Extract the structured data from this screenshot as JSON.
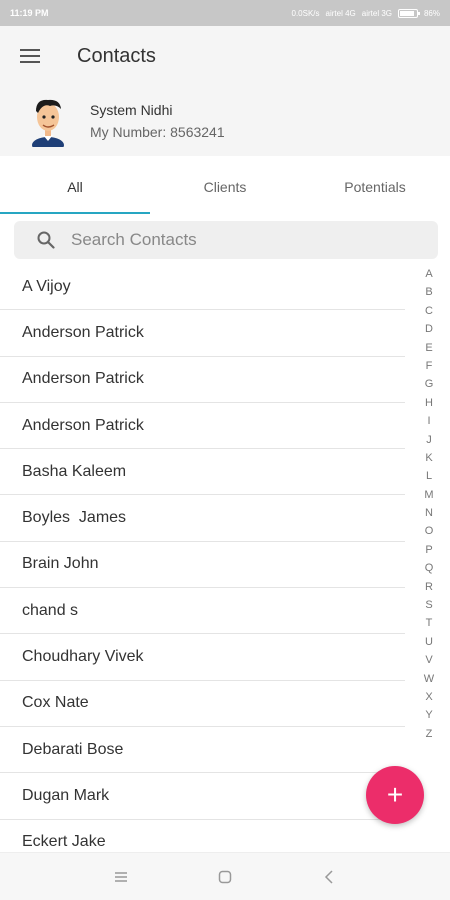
{
  "status_bar": {
    "time": "11:19 PM",
    "network_speed": "0.0SK/s",
    "carrier1": "airtel 4G",
    "carrier2": "airtel 3G",
    "battery": "86%"
  },
  "app_bar": {
    "title": "Contacts",
    "menu_icon": "hamburger-menu-icon"
  },
  "profile": {
    "name": "System Nidhi",
    "number": "My Number: 8563241"
  },
  "tabs": [
    {
      "label": "All",
      "active": true
    },
    {
      "label": "Clients",
      "active": false
    },
    {
      "label": "Potentials",
      "active": false
    }
  ],
  "search": {
    "placeholder": "Search Contacts"
  },
  "contacts": [
    "A Vijoy",
    "Anderson Patrick",
    "Anderson Patrick",
    "Anderson Patrick",
    "Basha Kaleem",
    "Boyles  James",
    "Brain John",
    "chand s",
    "Choudhary Vivek",
    "Cox Nate",
    "Debarati Bose",
    "Dugan Mark",
    "Eckert Jake"
  ],
  "alphabet": [
    "A",
    "B",
    "C",
    "D",
    "E",
    "F",
    "G",
    "H",
    "I",
    "J",
    "K",
    "L",
    "M",
    "N",
    "O",
    "P",
    "Q",
    "R",
    "S",
    "T",
    "U",
    "V",
    "W",
    "X",
    "Y",
    "Z"
  ],
  "fab": {
    "label": "+"
  },
  "colors": {
    "accent": "#26a6c2",
    "fab": "#ec2d6a",
    "header_bg": "#f5f5f5"
  }
}
